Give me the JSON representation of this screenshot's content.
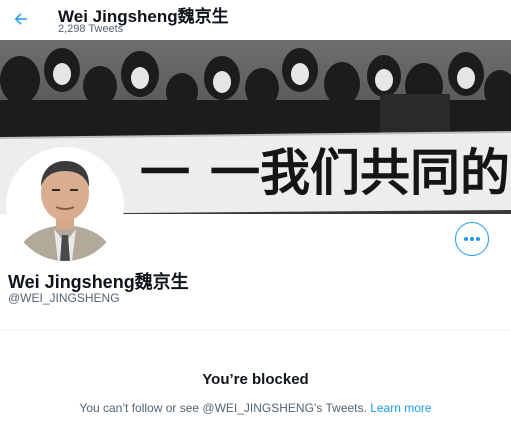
{
  "header": {
    "name": "Wei Jingsheng魏京生",
    "tweet_count": "2,298 Tweets",
    "back_icon": "arrow-left-icon"
  },
  "banner": {
    "banner_text": "一我们共同的",
    "description_icon": "protest-photo-banner"
  },
  "profile": {
    "name": "Wei Jingsheng魏京生",
    "handle": "@WEI_JINGSHENG",
    "more_icon": "more-options-icon"
  },
  "blocked": {
    "title": "You’re blocked",
    "message": "You can’t follow or see @WEI_JINGSHENG’s Tweets.",
    "learn_more": "Learn more"
  },
  "colors": {
    "accent": "#1d9bf0",
    "text_primary": "#0f1419",
    "text_secondary": "#536471"
  }
}
